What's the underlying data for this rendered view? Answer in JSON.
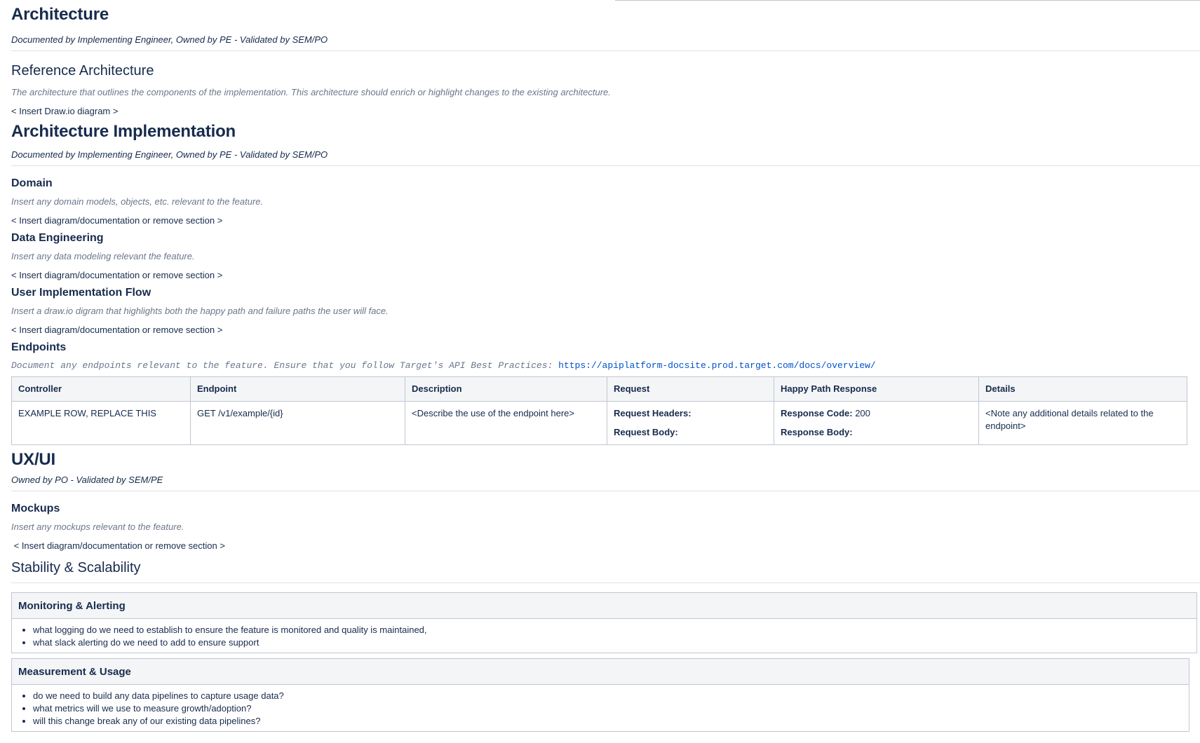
{
  "architecture": {
    "title": "Architecture",
    "owner": "Documented by Implementing Engineer, Owned by PE - Validated by SEM/PO"
  },
  "reference_architecture": {
    "title": "Reference Architecture",
    "hint": "The architecture that outlines the components of the implementation. This architecture should enrich or highlight changes to the existing architecture.",
    "insert": "< Insert Draw.io diagram >"
  },
  "architecture_implementation": {
    "title": "Architecture Implementation",
    "owner": "Documented by Implementing Engineer, Owned by PE - Validated by SEM/PO",
    "domain": {
      "title": "Domain",
      "hint": "Insert any domain models, objects, etc. relevant to the feature.",
      "insert": "< Insert diagram/documentation or remove section >"
    },
    "data_engineering": {
      "title": "Data Engineering",
      "hint": "Insert any data modeling relevant the feature.",
      "insert": "< Insert diagram/documentation or remove section >"
    },
    "user_flow": {
      "title": "User Implementation Flow",
      "hint": "Insert a draw.io digram that highlights both the happy path and failure paths the user will face.",
      "insert": "< Insert diagram/documentation or remove section >"
    },
    "endpoints": {
      "title": "Endpoints",
      "hint": "Document any endpoints relevant to the feature. Ensure that you follow Target's API Best Practices:",
      "link": "https://apiplatform-docsite.prod.target.com/docs/overview/",
      "columns": [
        "Controller",
        "Endpoint",
        "Description",
        "Request",
        "Happy Path Response",
        "Details"
      ],
      "row": {
        "controller": "EXAMPLE ROW, REPLACE THIS",
        "endpoint": "GET /v1/example/{id}",
        "description": "<Describe the use of the endpoint here>",
        "request_headers_label": "Request Headers:",
        "request_body_label": "Request Body:",
        "response_code_label": "Response Code:",
        "response_code_value": " 200",
        "response_body_label": "Response Body:",
        "details": "<Note any additional details related to the endpoint>"
      }
    }
  },
  "uxui": {
    "title": "UX/UI",
    "owner": "Owned by PO - Validated by SEM/PE",
    "mockups": {
      "title": "Mockups",
      "hint": "Insert any mockups relevant to the feature.",
      "insert": " < Insert diagram/documentation or remove section >"
    }
  },
  "stability": {
    "title": "Stability & Scalability",
    "monitoring": {
      "title": "Monitoring & Alerting",
      "items": [
        "what logging do we need to establish to ensure the feature is monitored and quality is maintained,",
        "what slack alerting do we need to add to ensure support"
      ]
    },
    "measurement": {
      "title": "Measurement & Usage",
      "items": [
        "do we need to build any data pipelines to capture usage data?",
        "what metrics will we use to measure growth/adoption?",
        "will this change break any of our existing data pipelines?"
      ]
    }
  }
}
